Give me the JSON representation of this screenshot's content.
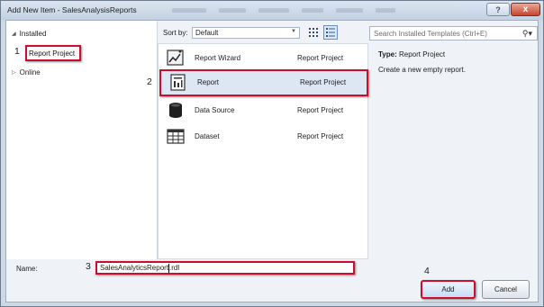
{
  "window": {
    "title": "Add New Item - SalesAnalysisReports"
  },
  "titlebar": {
    "help_label": "?",
    "close_label": "x"
  },
  "tree": {
    "installed_label": "Installed",
    "report_project_label": "Report Project",
    "online_label": "Online"
  },
  "sort": {
    "label": "Sort by:",
    "value": "Default"
  },
  "templates": [
    {
      "name": "Report Wizard",
      "type": "Report Project",
      "icon": "report-wizard-icon"
    },
    {
      "name": "Report",
      "type": "Report Project",
      "icon": "report-icon"
    },
    {
      "name": "Data Source",
      "type": "Report Project",
      "icon": "data-source-icon"
    },
    {
      "name": "Dataset",
      "type": "Report Project",
      "icon": "dataset-icon"
    }
  ],
  "search": {
    "placeholder": "Search Installed Templates (Ctrl+E)"
  },
  "details": {
    "type_label": "Type:",
    "type_value": "Report Project",
    "description": "Create a new empty report."
  },
  "name_field": {
    "label": "Name:",
    "value_before_caret": "SalesAnalyticsReport",
    "value_after_caret": ".rdl"
  },
  "buttons": {
    "add": "Add",
    "cancel": "Cancel"
  },
  "step_numbers": {
    "one": "1",
    "two": "2",
    "three": "3",
    "four": "4"
  },
  "colors": {
    "highlight": "#c8102e",
    "selected_row": "#dde6f3"
  }
}
